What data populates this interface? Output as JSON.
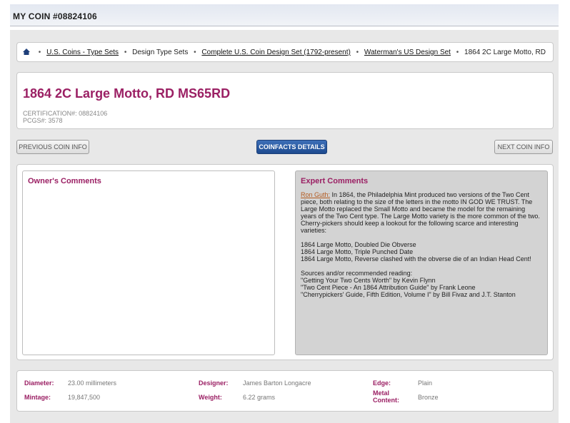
{
  "header": {
    "title": "MY COIN #08824106"
  },
  "breadcrumb": {
    "items": [
      {
        "label": "U.S. Coins - Type Sets"
      },
      {
        "label": "Design Type Sets"
      },
      {
        "label": "Complete U.S. Coin Design Set (1792-present)"
      },
      {
        "label": "Waterman's US Design Set"
      },
      {
        "label": "1864 2C Large Motto, RD"
      }
    ],
    "separator": "•"
  },
  "coin": {
    "title": "1864 2C Large Motto, RD MS65RD",
    "certification": "CERTIFICATION#: 08824106",
    "pcgs": "PCGS#: 3578"
  },
  "nav": {
    "previous": "PREVIOUS COIN INFO",
    "coinfacts": "COINFACTS DETAILS",
    "next": "NEXT COIN INFO"
  },
  "owner": {
    "title": "Owner's Comments"
  },
  "expert": {
    "title": "Expert Comments",
    "author": "Ron Guth:",
    "intro": "In 1864, the Philadelphia Mint produced two versions of the Two Cent piece, both relating to the size of the letters in the motto IN GOD WE TRUST. The Large Motto replaced the Small Motto and became the model for the remaining years of the Two Cent type. The Large Motto variety is the more common of the two. Cherry-pickers should keep a lookout for the following scarce and interesting varieties:",
    "varieties": [
      "1864 Large Motto, Doubled Die Obverse",
      "1864 Large Motto, Triple Punched Date",
      "1864 Large Motto, Reverse clashed with the obverse die of an Indian Head Cent!"
    ],
    "sources_heading": "Sources and/or recommended reading:",
    "sources": [
      "\"Getting Your Two Cents Worth\" by Kevin Flynn",
      "\"Two Cent Piece - An 1864 Attribution Guide\" by Frank Leone",
      "\"Cherrypickers' Guide, Fifth Edition, Volume I\" by Bill Fivaz and J.T. Stanton"
    ]
  },
  "specs": {
    "diameter_label": "Diameter:",
    "diameter": "23.00 millimeters",
    "mintage_label": "Mintage:",
    "mintage": "19,847,500",
    "designer_label": "Designer:",
    "designer": "James Barton Longacre",
    "weight_label": "Weight:",
    "weight": "6.22 grams",
    "edge_label": "Edge:",
    "edge": "Plain",
    "metal_label_1": "Metal",
    "metal_label_2": "Content:",
    "metal": "Bronze"
  },
  "colors": {
    "accent": "#9b2064",
    "button_blue": "#1d4a8f",
    "expert_bg": "#d3d3d3"
  }
}
